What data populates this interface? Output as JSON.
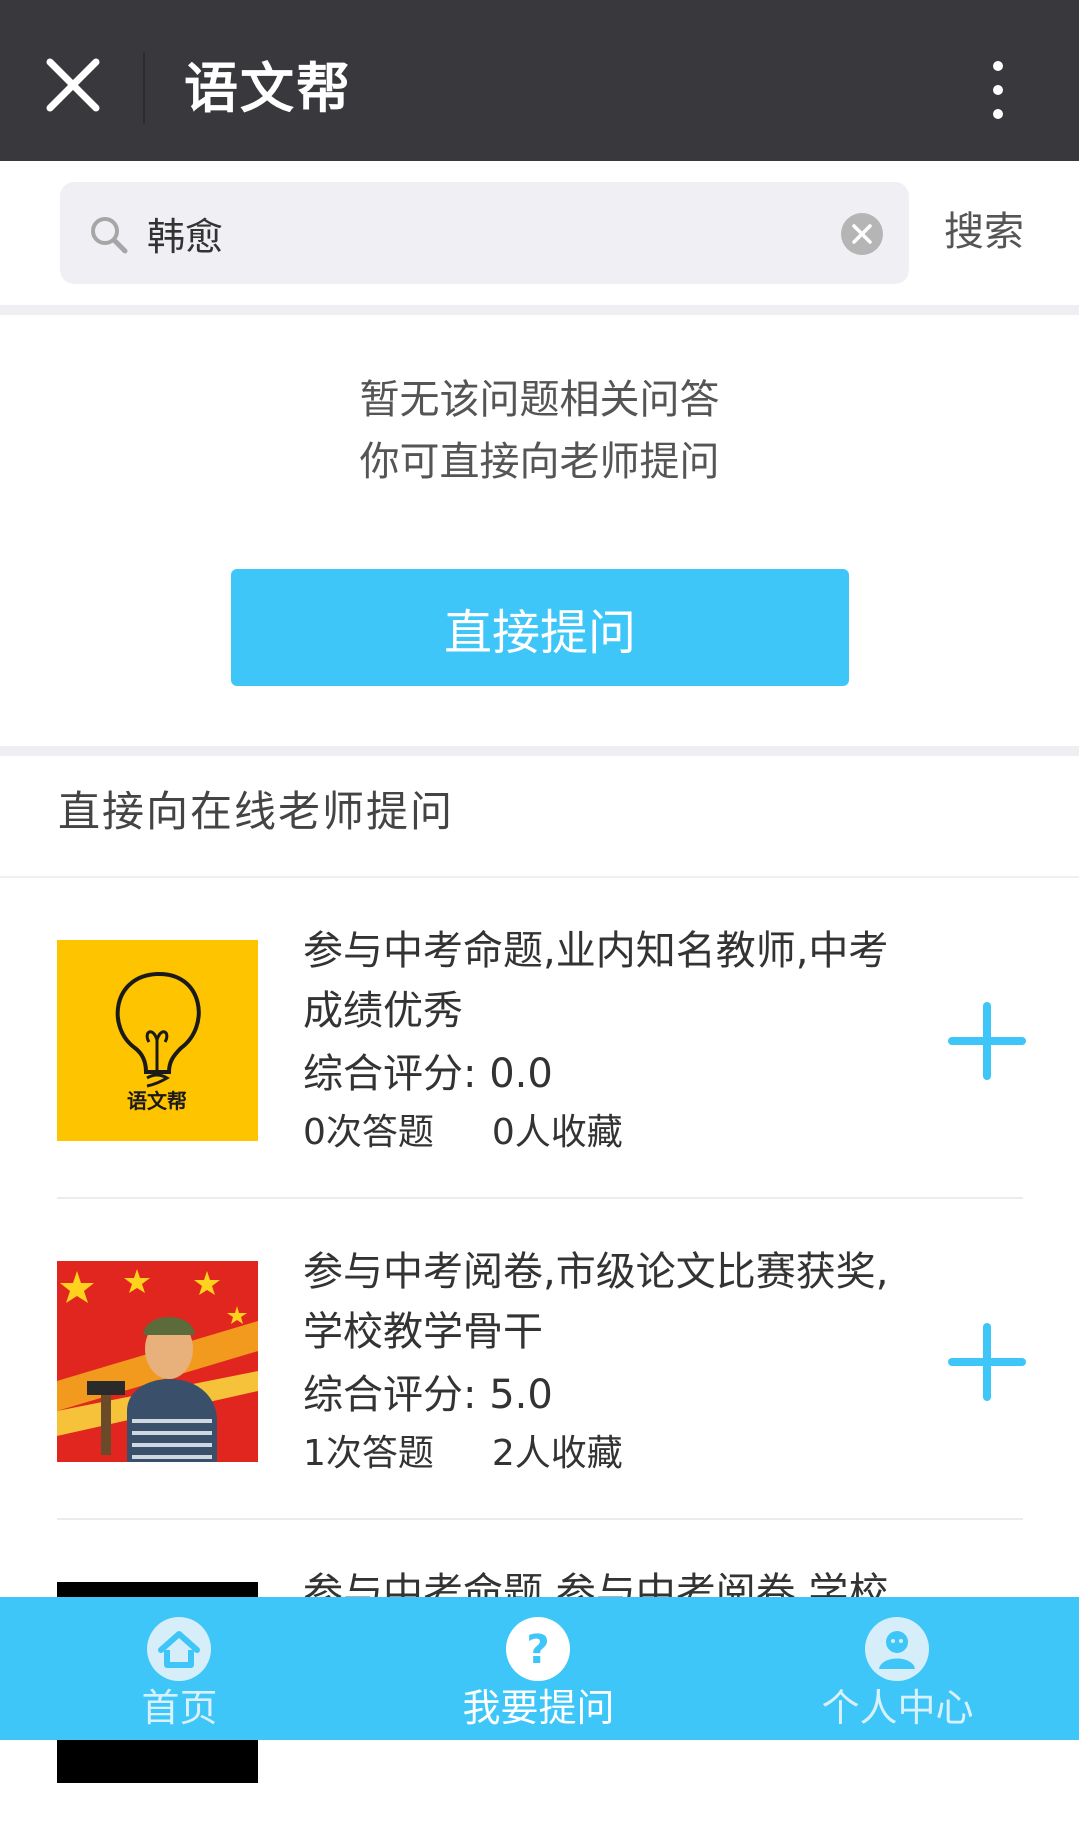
{
  "header": {
    "title": "语文帮",
    "close_icon": "close-icon",
    "more_icon": "more-vertical-icon"
  },
  "search": {
    "value": "韩愈",
    "placeholder": "",
    "button_label": "搜索"
  },
  "empty_state": {
    "line1": "暂无该问题相关问答",
    "line2": "你可直接向老师提问",
    "ask_button": "直接提问"
  },
  "teachers_section": {
    "title": "直接向在线老师提问",
    "items": [
      {
        "desc_line1": "参与中考命题,业内知名教师,中考",
        "desc_line2": "成绩优秀",
        "rating": "综合评分: 0.0",
        "answers": "0次答题",
        "favorites": "0人收藏",
        "avatar_label": "语文帮"
      },
      {
        "desc_line1": "参与中考阅卷,市级论文比赛获奖,",
        "desc_line2": "学校教学骨干",
        "rating": "综合评分: 5.0",
        "answers": "1次答题",
        "favorites": "2人收藏"
      },
      {
        "desc_line1": "参与中考命题,参与中考阅卷,学校"
      }
    ]
  },
  "bottom_nav": {
    "home": "首页",
    "ask": "我要提问",
    "profile": "个人中心"
  },
  "colors": {
    "accent": "#3fc6f8",
    "header_bg": "#38383d",
    "avatar1_bg": "#ffc400"
  }
}
